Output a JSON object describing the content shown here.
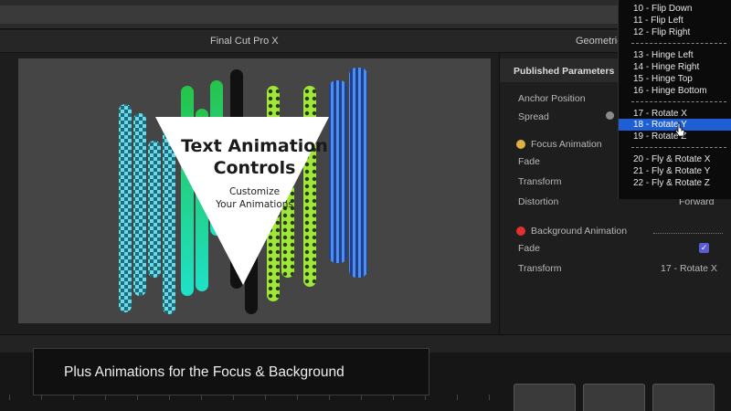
{
  "window": {
    "title": "Final Cut Pro X",
    "inspector_tab": "Geometric"
  },
  "viewer": {
    "title_line1": "Text Animation",
    "title_line2": "Controls",
    "subtitle_line1": "Customize",
    "subtitle_line2": "Your Animations"
  },
  "inspector": {
    "header": "Published Parameters",
    "anchor_label": "Anchor Position",
    "spread_label": "Spread",
    "focus_section": "Focus Animation",
    "focus_fade_label": "Fade",
    "focus_transform_label": "Transform",
    "focus_distortion_label": "Distortion",
    "focus_distortion_value": "Forward",
    "bg_section": "Background Animation",
    "bg_fade_label": "Fade",
    "bg_fade_checked": true,
    "bg_transform_label": "Transform",
    "bg_transform_value": "17 - Rotate X"
  },
  "dropdown": {
    "items": [
      "10 - Flip Down",
      "11 - Flip Left",
      "12 - Flip Right",
      "13 - Hinge Left",
      "14 - Hinge Right",
      "15 - Hinge Top",
      "16 - Hinge Bottom",
      "17 - Rotate X",
      "18 - Rotate Y",
      "19 - Rotate Z",
      "20 - Fly & Rotate X",
      "21 - Fly & Rotate Y",
      "22 - Fly & Rotate Z"
    ],
    "selected": "18 - Rotate Y"
  },
  "caption": {
    "text": "Plus Animations for the Focus & Background"
  },
  "colors": {
    "highlight": "#1f5fd6",
    "checkbox": "#5b5bd6",
    "focus_icon": "#e0b040",
    "bg_icon": "#e03030"
  }
}
